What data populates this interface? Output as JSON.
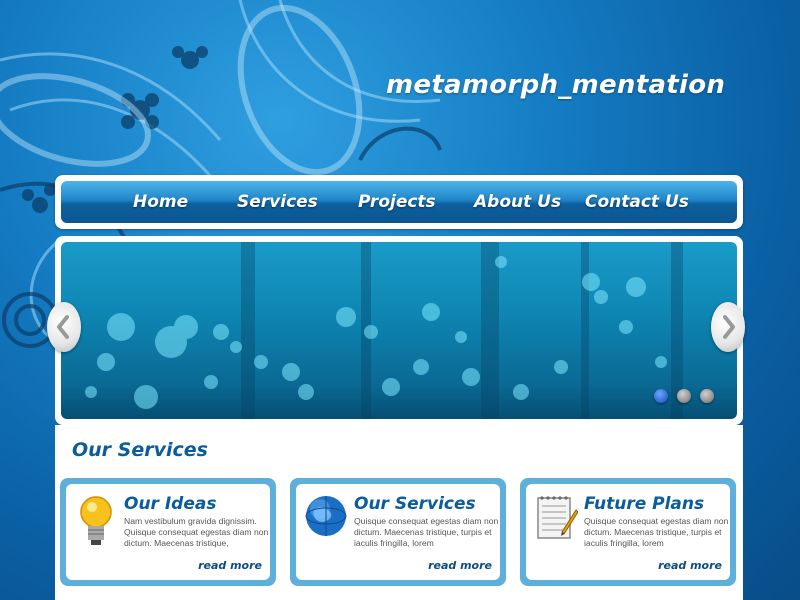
{
  "site": {
    "title": "metamorph_mentation"
  },
  "nav": {
    "items": [
      "Home",
      "Services",
      "Projects",
      "About Us",
      "Contact Us"
    ]
  },
  "slider": {
    "active_index": 0,
    "slide_count": 3
  },
  "services": {
    "heading": "Our Services",
    "cards": [
      {
        "icon": "lightbulb-icon",
        "title": "Our Ideas",
        "text": "Nam vestibulum gravida dignissim. Quisque consequat egestas diam non dictum. Maecenas tristique,",
        "link": "read more"
      },
      {
        "icon": "globe-icon",
        "title": "Our Services",
        "text": "Quisque consequat egestas diam non dictum. Maecenas tristique, turpis et iaculis fringilla, lorem",
        "link": "read more"
      },
      {
        "icon": "notepad-pen-icon",
        "title": "Future Plans",
        "text": "Quisque consequat egestas diam non dictum. Maecenas tristique, turpis et iaculis fringilla, lorem",
        "link": "read more"
      }
    ]
  },
  "colors": {
    "brand_blue": "#0a5c9c",
    "card_border": "#5eafd9"
  }
}
